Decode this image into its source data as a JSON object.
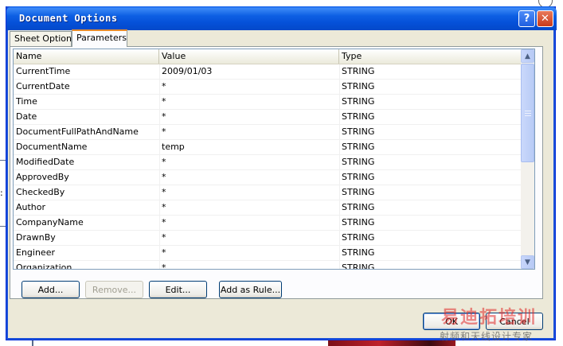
{
  "window": {
    "title": "Document Options",
    "help_glyph": "?",
    "close_glyph": "✕"
  },
  "tabs": [
    {
      "label": "Sheet Options"
    },
    {
      "label": "Parameters"
    }
  ],
  "grid": {
    "columns": [
      "Name",
      "Value",
      "Type"
    ],
    "rows": [
      {
        "name": "CurrentTime",
        "value": "2009/01/03",
        "type": "STRING"
      },
      {
        "name": "CurrentDate",
        "value": "*",
        "type": "STRING"
      },
      {
        "name": "Time",
        "value": "*",
        "type": "STRING"
      },
      {
        "name": "Date",
        "value": "*",
        "type": "STRING"
      },
      {
        "name": "DocumentFullPathAndName",
        "value": "*",
        "type": "STRING"
      },
      {
        "name": "DocumentName",
        "value": "temp",
        "type": "STRING"
      },
      {
        "name": "ModifiedDate",
        "value": "*",
        "type": "STRING"
      },
      {
        "name": "ApprovedBy",
        "value": "*",
        "type": "STRING"
      },
      {
        "name": "CheckedBy",
        "value": "*",
        "type": "STRING"
      },
      {
        "name": "Author",
        "value": "*",
        "type": "STRING"
      },
      {
        "name": "CompanyName",
        "value": "*",
        "type": "STRING"
      },
      {
        "name": "DrawnBy",
        "value": "*",
        "type": "STRING"
      },
      {
        "name": "Engineer",
        "value": "*",
        "type": "STRING"
      },
      {
        "name": "Organization",
        "value": "*",
        "type": "STRING"
      }
    ]
  },
  "buttons": {
    "add": "Add...",
    "remove": "Remove...",
    "edit": "Edit...",
    "add_as_rule": "Add as Rule...",
    "ok": "OK",
    "cancel": "Cancel"
  },
  "watermark": {
    "line1": "易迪拓培训",
    "line2": "射频和天线设计专家"
  },
  "background": {
    "colon_glyph": ":"
  },
  "colors": {
    "titlebar": "#0550d8",
    "dialog_bg": "#ece9d8",
    "active_tab_accent": "#e68b2c"
  }
}
